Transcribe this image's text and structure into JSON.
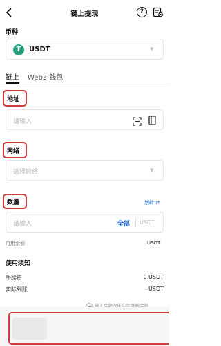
{
  "header": {
    "title": "链上提现",
    "help_icon": "?"
  },
  "coin": {
    "label": "币种",
    "name": "USDT",
    "icon_symbol": "₮",
    "accent": "#26a17b"
  },
  "tabs": [
    {
      "label": "链上"
    },
    {
      "label": "Web3 钱包"
    }
  ],
  "address": {
    "label": "地址",
    "placeholder": "请输入"
  },
  "network": {
    "label": "网络",
    "placeholder": "选择网络"
  },
  "amount": {
    "label": "数量",
    "transfer_link": "划转 ⇄",
    "placeholder": "请输入",
    "all_button": "全部",
    "unit": "USDT",
    "available_label": "可用余额",
    "available_value": "USDT"
  },
  "notes": {
    "title": "使用须知",
    "fee_label": "手续费",
    "fee_value": "0 USDT",
    "received_label": "实际到账",
    "received_value": "--USDT",
    "toggle_text": "输入金额改成实际到账金额"
  },
  "colors": {
    "highlight": "#d23b3b",
    "link": "#1e6fd9"
  }
}
